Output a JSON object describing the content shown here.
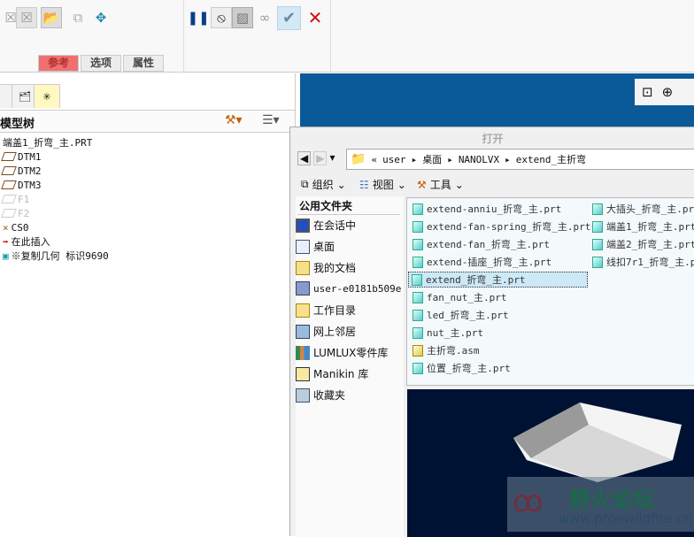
{
  "ribbon": {
    "tabs": [
      {
        "label": "参考",
        "active": true
      },
      {
        "label": "选项"
      },
      {
        "label": "属性"
      }
    ],
    "icons": [
      "remove-icon",
      "remove-icon",
      "open-folder-icon",
      "copy-geometry-icon",
      "move-icon",
      "pause-icon",
      "stop-icon",
      "preview-icon",
      "glasses-icon",
      "ok-check-icon",
      "cancel-x-icon"
    ]
  },
  "graphics_toolbar": {
    "icons": [
      "zoom-window-icon",
      "zoom-in-icon"
    ]
  },
  "model_tree": {
    "title": "模型树",
    "items": [
      {
        "label": "端盖1_折弯_主.PRT",
        "icon": "none"
      },
      {
        "label": "DTM1",
        "icon": "datum-plane-icon"
      },
      {
        "label": "DTM2",
        "icon": "datum-plane-icon"
      },
      {
        "label": "DTM3",
        "icon": "datum-plane-icon"
      },
      {
        "label": "F1",
        "icon": "datum-plane-icon",
        "disabled": true
      },
      {
        "label": "F2",
        "icon": "datum-plane-icon",
        "disabled": true
      },
      {
        "label": "CS0",
        "icon": "coordinate-system-icon"
      },
      {
        "label": "在此插入",
        "icon": "insert-arrow-icon"
      },
      {
        "label": "※复制几何 标识9690",
        "icon": "copy-geometry-icon"
      }
    ]
  },
  "dialog": {
    "title": "打开",
    "breadcrumb": [
      "«",
      "user",
      "桌面",
      "NANOLVX",
      "extend_主折弯"
    ],
    "toolbar": {
      "organize": "组织",
      "view": "视图",
      "tools": "工具"
    },
    "sidebar": {
      "title": "公用文件夹",
      "items": [
        "在会话中",
        "桌面",
        "我的文档",
        "user-e0181b509e",
        "工作目录",
        "网上邻居",
        "LUMLUX零件库",
        "Manikin 库",
        "收藏夹"
      ]
    },
    "files_col1": [
      "extend-anniu_折弯_主.prt",
      "extend-fan-spring_折弯_主.prt",
      "extend-fan_折弯_主.prt",
      "extend-插座_折弯_主.prt",
      "extend_折弯_主.prt",
      "fan_nut_主.prt",
      "led_折弯_主.prt",
      "nut_主.prt",
      "主折弯.asm",
      "位置_折弯_主.prt"
    ],
    "files_col2": [
      "大插头_折弯_主.prt",
      "端盖1_折弯_主.prt",
      "端盖2_折弯_主.prt",
      "线扣7r1_折弯_主.prt"
    ],
    "selected": "extend_折弯_主.prt"
  },
  "watermark": {
    "title": "野火论坛",
    "url": "www.proewildfire.cn"
  },
  "colors": {
    "graphics_bg": "#0a5a9a",
    "preview_bg": "#001233",
    "active_tab": "#f07070"
  }
}
